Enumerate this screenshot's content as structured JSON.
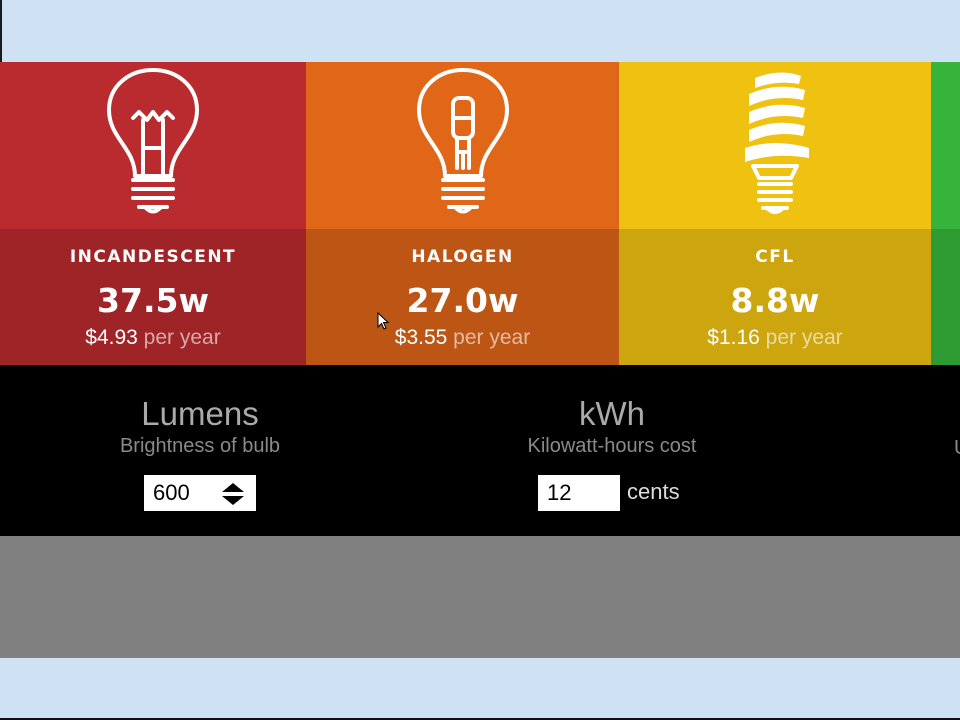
{
  "bulbs": [
    {
      "name": "INCANDESCENT",
      "watts": "37.5w",
      "cost": "$4.93",
      "per": "per year",
      "color": "#b92b2e"
    },
    {
      "name": "HALOGEN",
      "watts": "27.0w",
      "cost": "$3.55",
      "per": "per year",
      "color": "#e06717"
    },
    {
      "name": "CFL",
      "watts": "8.8w",
      "cost": "$1.16",
      "per": "per year",
      "color": "#efc211"
    },
    {
      "name": "",
      "color": "#37b33c"
    }
  ],
  "controls": {
    "lumens": {
      "title": "Lumens",
      "subtitle": "Brightness of bulb",
      "value": "600"
    },
    "kwh": {
      "title": "kWh",
      "subtitle": "Kilowatt-hours cost",
      "value": "12",
      "unit": "cents"
    },
    "third_subtitle_fragment": "U"
  },
  "icons": [
    "incandescent-bulb-icon",
    "halogen-bulb-icon",
    "cfl-bulb-icon",
    "spinner-arrows-icon",
    "mouse-cursor-icon"
  ]
}
